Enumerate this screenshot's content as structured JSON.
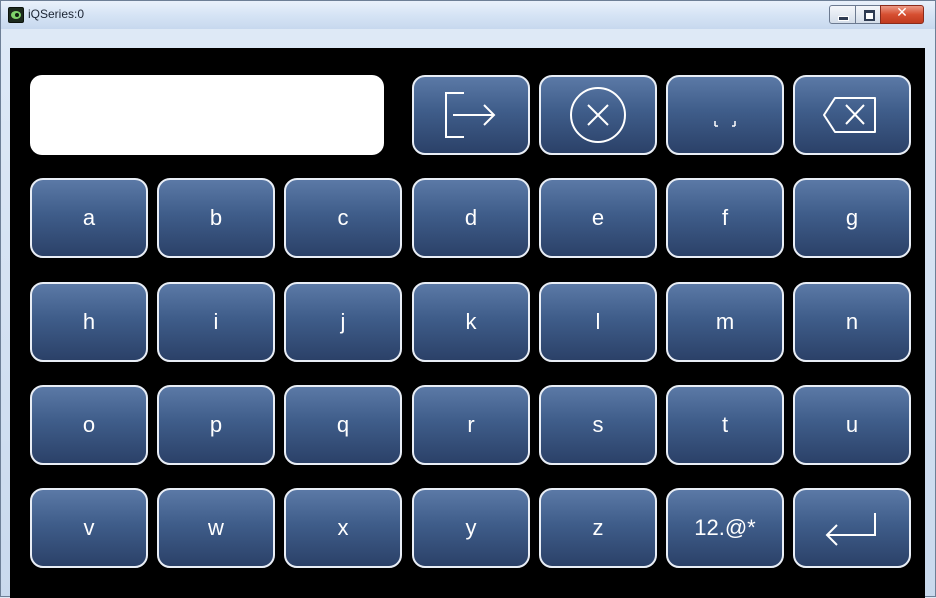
{
  "window": {
    "title": "iQSeries:0",
    "controls": {
      "close_glyph": "✕"
    }
  },
  "keyboard": {
    "input_value": "",
    "function_keys": [
      {
        "name": "exit-icon"
      },
      {
        "name": "cancel-icon"
      },
      {
        "name": "space-icon"
      },
      {
        "name": "backspace-icon"
      }
    ],
    "rows": [
      [
        "a",
        "b",
        "c",
        "d",
        "e",
        "f",
        "g"
      ],
      [
        "h",
        "i",
        "j",
        "k",
        "l",
        "m",
        "n"
      ],
      [
        "o",
        "p",
        "q",
        "r",
        "s",
        "t",
        "u"
      ],
      [
        "v",
        "w",
        "x",
        "y",
        "z",
        "12.@*"
      ]
    ],
    "enter_key": {
      "name": "enter-icon"
    }
  }
}
